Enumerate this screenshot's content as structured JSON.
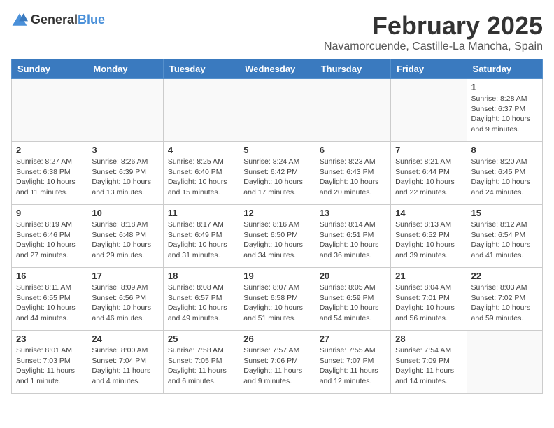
{
  "header": {
    "logo_general": "General",
    "logo_blue": "Blue",
    "month_title": "February 2025",
    "location": "Navamorcuende, Castille-La Mancha, Spain"
  },
  "days_of_week": [
    "Sunday",
    "Monday",
    "Tuesday",
    "Wednesday",
    "Thursday",
    "Friday",
    "Saturday"
  ],
  "weeks": [
    [
      {
        "day": "",
        "info": ""
      },
      {
        "day": "",
        "info": ""
      },
      {
        "day": "",
        "info": ""
      },
      {
        "day": "",
        "info": ""
      },
      {
        "day": "",
        "info": ""
      },
      {
        "day": "",
        "info": ""
      },
      {
        "day": "1",
        "info": "Sunrise: 8:28 AM\nSunset: 6:37 PM\nDaylight: 10 hours and 9 minutes."
      }
    ],
    [
      {
        "day": "2",
        "info": "Sunrise: 8:27 AM\nSunset: 6:38 PM\nDaylight: 10 hours and 11 minutes."
      },
      {
        "day": "3",
        "info": "Sunrise: 8:26 AM\nSunset: 6:39 PM\nDaylight: 10 hours and 13 minutes."
      },
      {
        "day": "4",
        "info": "Sunrise: 8:25 AM\nSunset: 6:40 PM\nDaylight: 10 hours and 15 minutes."
      },
      {
        "day": "5",
        "info": "Sunrise: 8:24 AM\nSunset: 6:42 PM\nDaylight: 10 hours and 17 minutes."
      },
      {
        "day": "6",
        "info": "Sunrise: 8:23 AM\nSunset: 6:43 PM\nDaylight: 10 hours and 20 minutes."
      },
      {
        "day": "7",
        "info": "Sunrise: 8:21 AM\nSunset: 6:44 PM\nDaylight: 10 hours and 22 minutes."
      },
      {
        "day": "8",
        "info": "Sunrise: 8:20 AM\nSunset: 6:45 PM\nDaylight: 10 hours and 24 minutes."
      }
    ],
    [
      {
        "day": "9",
        "info": "Sunrise: 8:19 AM\nSunset: 6:46 PM\nDaylight: 10 hours and 27 minutes."
      },
      {
        "day": "10",
        "info": "Sunrise: 8:18 AM\nSunset: 6:48 PM\nDaylight: 10 hours and 29 minutes."
      },
      {
        "day": "11",
        "info": "Sunrise: 8:17 AM\nSunset: 6:49 PM\nDaylight: 10 hours and 31 minutes."
      },
      {
        "day": "12",
        "info": "Sunrise: 8:16 AM\nSunset: 6:50 PM\nDaylight: 10 hours and 34 minutes."
      },
      {
        "day": "13",
        "info": "Sunrise: 8:14 AM\nSunset: 6:51 PM\nDaylight: 10 hours and 36 minutes."
      },
      {
        "day": "14",
        "info": "Sunrise: 8:13 AM\nSunset: 6:52 PM\nDaylight: 10 hours and 39 minutes."
      },
      {
        "day": "15",
        "info": "Sunrise: 8:12 AM\nSunset: 6:54 PM\nDaylight: 10 hours and 41 minutes."
      }
    ],
    [
      {
        "day": "16",
        "info": "Sunrise: 8:11 AM\nSunset: 6:55 PM\nDaylight: 10 hours and 44 minutes."
      },
      {
        "day": "17",
        "info": "Sunrise: 8:09 AM\nSunset: 6:56 PM\nDaylight: 10 hours and 46 minutes."
      },
      {
        "day": "18",
        "info": "Sunrise: 8:08 AM\nSunset: 6:57 PM\nDaylight: 10 hours and 49 minutes."
      },
      {
        "day": "19",
        "info": "Sunrise: 8:07 AM\nSunset: 6:58 PM\nDaylight: 10 hours and 51 minutes."
      },
      {
        "day": "20",
        "info": "Sunrise: 8:05 AM\nSunset: 6:59 PM\nDaylight: 10 hours and 54 minutes."
      },
      {
        "day": "21",
        "info": "Sunrise: 8:04 AM\nSunset: 7:01 PM\nDaylight: 10 hours and 56 minutes."
      },
      {
        "day": "22",
        "info": "Sunrise: 8:03 AM\nSunset: 7:02 PM\nDaylight: 10 hours and 59 minutes."
      }
    ],
    [
      {
        "day": "23",
        "info": "Sunrise: 8:01 AM\nSunset: 7:03 PM\nDaylight: 11 hours and 1 minute."
      },
      {
        "day": "24",
        "info": "Sunrise: 8:00 AM\nSunset: 7:04 PM\nDaylight: 11 hours and 4 minutes."
      },
      {
        "day": "25",
        "info": "Sunrise: 7:58 AM\nSunset: 7:05 PM\nDaylight: 11 hours and 6 minutes."
      },
      {
        "day": "26",
        "info": "Sunrise: 7:57 AM\nSunset: 7:06 PM\nDaylight: 11 hours and 9 minutes."
      },
      {
        "day": "27",
        "info": "Sunrise: 7:55 AM\nSunset: 7:07 PM\nDaylight: 11 hours and 12 minutes."
      },
      {
        "day": "28",
        "info": "Sunrise: 7:54 AM\nSunset: 7:09 PM\nDaylight: 11 hours and 14 minutes."
      },
      {
        "day": "",
        "info": ""
      }
    ]
  ]
}
